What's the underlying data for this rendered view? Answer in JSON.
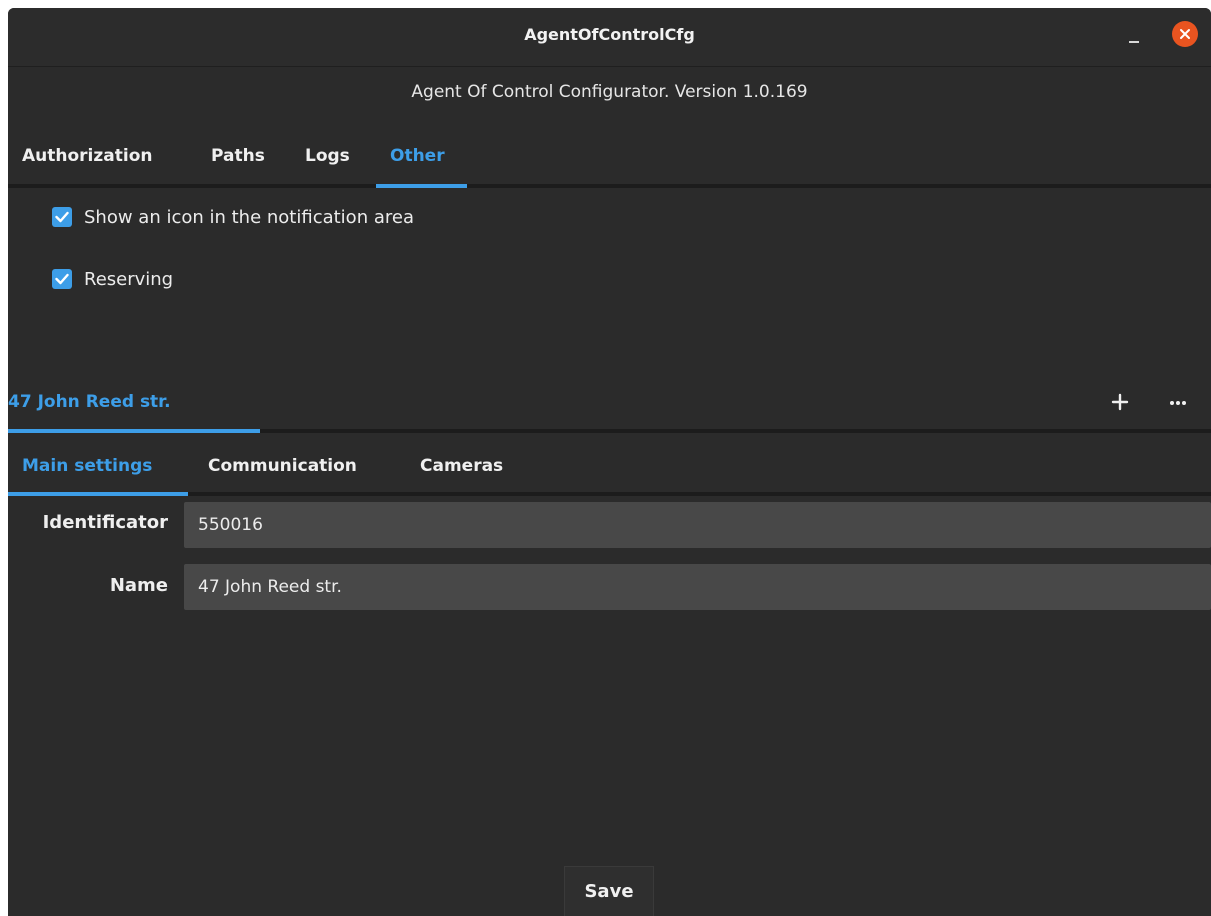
{
  "window": {
    "title": "AgentOfControlCfg"
  },
  "header": {
    "version_text": "Agent Of Control Configurator. Version 1.0.169"
  },
  "tabs": [
    {
      "label": "Authorization",
      "active": false
    },
    {
      "label": "Paths",
      "active": false
    },
    {
      "label": "Logs",
      "active": false
    },
    {
      "label": "Other",
      "active": true
    }
  ],
  "options": {
    "show_icon": {
      "label": "Show an icon in the notification area",
      "checked": true
    },
    "reserving": {
      "label": "Reserving",
      "checked": true
    }
  },
  "location": {
    "tab_label": "47 John Reed str.",
    "add_icon": "plus-icon",
    "more_icon": "ellipsis-icon"
  },
  "subtabs": [
    {
      "label": "Main settings",
      "active": true
    },
    {
      "label": "Communication",
      "active": false
    },
    {
      "label": "Cameras",
      "active": false
    }
  ],
  "fields": {
    "identificator": {
      "label": "Identificator",
      "value": "550016"
    },
    "name": {
      "label": "Name",
      "value": "47 John Reed str."
    }
  },
  "footer": {
    "save_label": "Save"
  },
  "colors": {
    "accent": "#3d9ee8",
    "close": "#e95420",
    "background": "#2b2b2b",
    "input_bg": "#484848"
  }
}
